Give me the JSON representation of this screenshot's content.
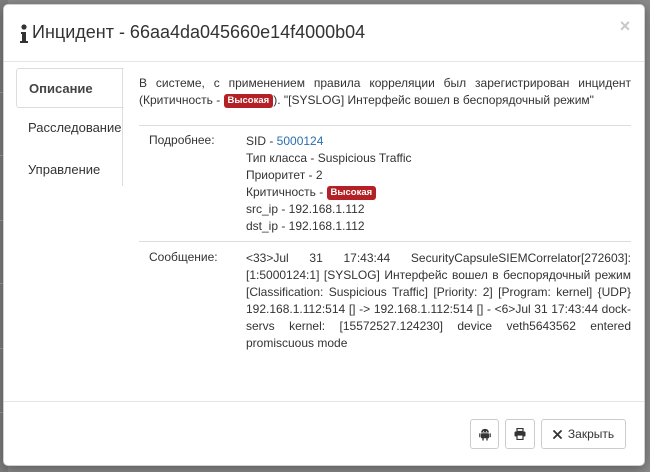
{
  "modal": {
    "title_icon": "info-icon",
    "title": "Инцидент - 66aa4da045660e14f4000b04",
    "close_icon": "close-icon"
  },
  "tabs": [
    {
      "label": "Описание",
      "active": true
    },
    {
      "label": "Расследование",
      "active": false
    },
    {
      "label": "Управление",
      "active": false
    }
  ],
  "description": {
    "intro_before": "В системе, с применением правила корреляции был зарегистрирован инцидент (Критичность -",
    "severity_badge": "Высокая",
    "intro_after": "). \"[SYSLOG] Интерфейс вошел в беспорядочный режим\"",
    "details_label": "Подробнее:",
    "sid_prefix": "SID - ",
    "sid_value": "5000124",
    "class_type": "Тип класса - Suspicious Traffic",
    "priority": "Приоритет - 2",
    "criticality_prefix": "Критичность -",
    "criticality_badge": "Высокая",
    "src_ip": "src_ip - 192.168.1.112",
    "dst_ip": "dst_ip - 192.168.1.112",
    "message_label": "Сообщение:",
    "message": "<33>Jul 31 17:43:44 SecurityCapsuleSIEMCorrelator[272603]: [1:5000124:1] [SYSLOG] Интерфейс вошел в беспорядочный режим [Classification: Suspicious Traffic] [Priority: 2] [Program: kernel] {UDP} 192.168.1.112:514 [] -> 192.168.1.112:514 [] - <6>Jul 31 17:43:44 dock-servs kernel: [15572527.124230] device veth5643562 entered promiscuous mode"
  },
  "footer": {
    "android_icon": "android-icon",
    "print_icon": "print-icon",
    "close_icon": "close-icon",
    "close_label": "Закрыть"
  },
  "colors": {
    "badge": "#b32025",
    "link": "#2a6eb4"
  }
}
